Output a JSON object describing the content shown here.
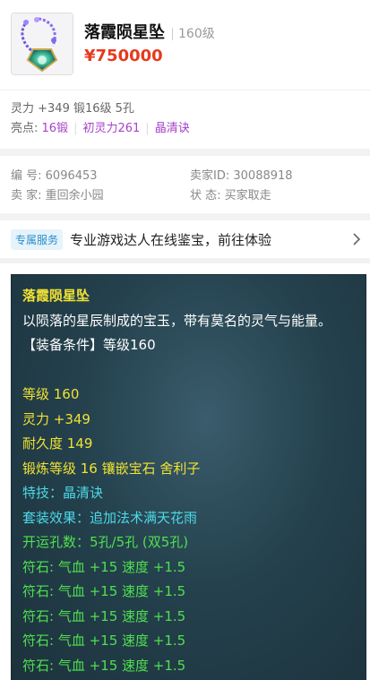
{
  "item": {
    "name": "落霞陨星坠",
    "level": "160级",
    "price": "¥750000"
  },
  "attrs": {
    "line1": "灵力 +349 锻16级 5孔",
    "highlights_label": "亮点:",
    "highlights": [
      "16锻",
      "初灵力261",
      "晶清诀"
    ]
  },
  "info": {
    "id_label": "编  号:",
    "id_value": "6096453",
    "seller_id_label": "卖家ID:",
    "seller_id_value": "30088918",
    "seller_label": "卖  家:",
    "seller_value": "重回余小园",
    "status_label": "状  态:",
    "status_value": "买家取走"
  },
  "service": {
    "badge": "专属服务",
    "text": "专业游戏达人在线鉴宝，前往体验"
  },
  "detail": {
    "title": "落霞陨星坠",
    "desc": "以陨落的星辰制成的宝玉，带有莫名的灵气与能量。",
    "requirement": "【装备条件】等级160",
    "level": "等级 160",
    "spirit": "灵力 +349",
    "durability": "耐久度 149",
    "forge": "锻炼等级 16 镶嵌宝石 舍利子",
    "skill": "特技：晶清诀",
    "set_effect": "套装效果：追加法术满天花雨",
    "holes": "开运孔数：5孔/5孔 (双5孔)",
    "runes": [
      "符石: 气血 +15 速度 +1.5",
      "符石: 气血 +15 速度 +1.5",
      "符石: 气血 +15 速度 +1.5",
      "符石: 气血 +15 速度 +1.5",
      "符石: 气血 +15 速度 +1.5"
    ]
  },
  "colors": {
    "price": "#e8391d",
    "highlight": "#a641c9",
    "badge": "#2a8fc9",
    "detail_yellow": "#f0e233",
    "detail_cyan": "#4cd9e6",
    "detail_green": "#4fe04f"
  }
}
